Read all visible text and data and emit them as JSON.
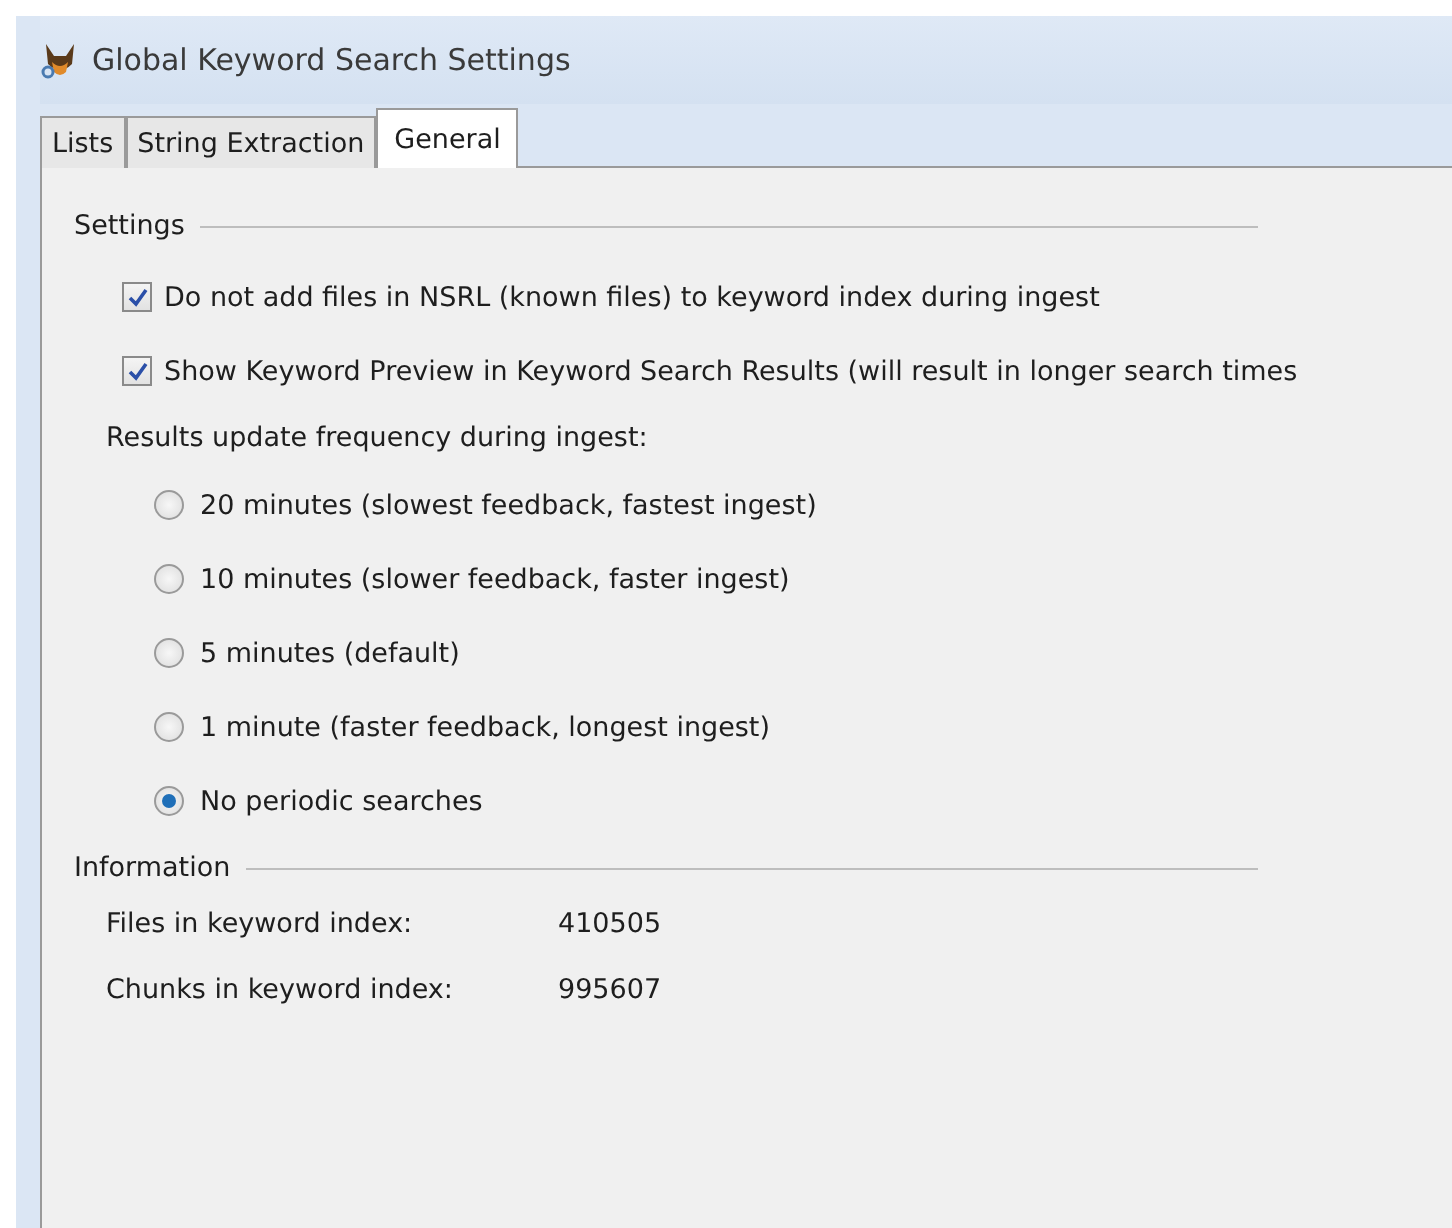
{
  "window": {
    "title": "Global Keyword Search Settings"
  },
  "tabs": [
    {
      "label": "Lists",
      "selected": false
    },
    {
      "label": "String Extraction",
      "selected": false
    },
    {
      "label": "General",
      "selected": true
    }
  ],
  "settings": {
    "heading": "Settings",
    "checkboxes": [
      {
        "label": "Do not add files in NSRL (known files) to keyword index during ingest",
        "checked": true
      },
      {
        "label": "Show Keyword Preview in Keyword Search Results (will result in longer search times",
        "checked": true
      }
    ],
    "frequency_label": "Results update frequency during ingest:",
    "frequency_options": [
      {
        "label": "20 minutes (slowest feedback, fastest ingest)",
        "selected": false
      },
      {
        "label": "10 minutes (slower feedback, faster ingest)",
        "selected": false
      },
      {
        "label": "5 minutes (default)",
        "selected": false
      },
      {
        "label": "1 minute (faster feedback, longest ingest)",
        "selected": false
      },
      {
        "label": "No periodic searches",
        "selected": true
      }
    ]
  },
  "information": {
    "heading": "Information",
    "rows": [
      {
        "label": "Files in keyword index:",
        "value": "410505"
      },
      {
        "label": "Chunks in keyword index:",
        "value": "995607"
      }
    ]
  }
}
